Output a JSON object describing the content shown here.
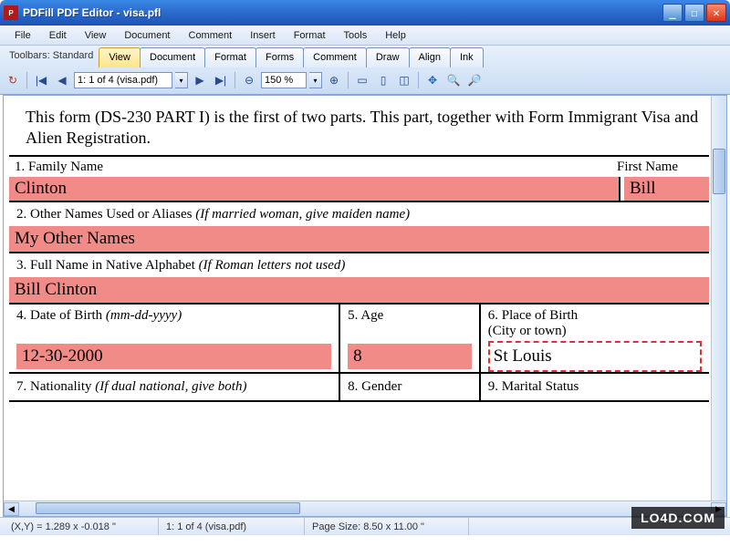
{
  "window": {
    "title": "PDFill PDF Editor - visa.pfl",
    "appicon_letter": "P"
  },
  "menus": [
    "File",
    "Edit",
    "View",
    "Document",
    "Comment",
    "Insert",
    "Format",
    "Tools",
    "Help"
  ],
  "tabstrip": {
    "label": "Toolbars: Standard",
    "tabs": [
      "View",
      "Document",
      "Format",
      "Forms",
      "Comment",
      "Draw",
      "Align",
      "Ink"
    ],
    "active": "View"
  },
  "toolbar": {
    "page_info": "1: 1 of 4 (visa.pdf)",
    "zoom": "150 %"
  },
  "document": {
    "intro": "This form (DS-230 PART I) is the first of two parts.  This part, together with Form Immigrant Visa and Alien Registration.",
    "fields": {
      "r1": {
        "label_family": "1. Family Name",
        "label_first": "First Name",
        "family": "Clinton",
        "first": "Bill"
      },
      "r2": {
        "label": "2. Other Names Used or Aliases",
        "hint": "(If married woman, give maiden name)",
        "value": "My Other Names"
      },
      "r3": {
        "label": "3. Full Name in Native Alphabet",
        "hint": "(If Roman letters not used)",
        "value": "Bill Clinton"
      },
      "r4": {
        "label": "4. Date of Birth",
        "hint": "(mm-dd-yyyy)",
        "value": "12-30-2000"
      },
      "r5": {
        "label": "5. Age",
        "value": "8"
      },
      "r6": {
        "label": "6. Place of Birth",
        "sub": "(City or town)",
        "value": "St Louis"
      },
      "r7": {
        "label": "7. Nationality",
        "hint": "(If dual national, give both)"
      },
      "r8": {
        "label": "8. Gender"
      },
      "r9": {
        "label": "9. Marital Status"
      }
    }
  },
  "statusbar": {
    "coords": "(X,Y) = 1.289 x -0.018 \"",
    "page": "1: 1 of 4 (visa.pdf)",
    "pagesize": "Page Size: 8.50 x 11.00 \""
  },
  "watermark": "LO4D.COM"
}
